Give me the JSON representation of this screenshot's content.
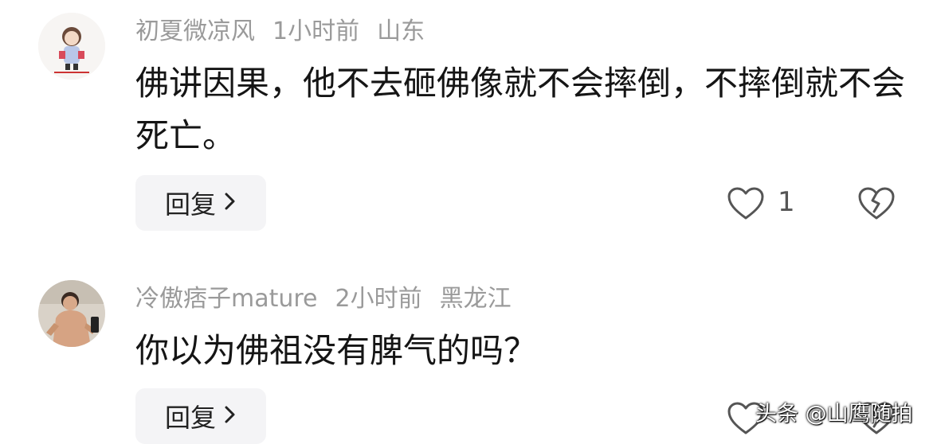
{
  "comments": [
    {
      "username": "初夏微凉风",
      "time": "1小时前",
      "location": "山东",
      "text": "佛讲因果，他不去砸佛像就不会摔倒，不摔倒就不会死亡。",
      "reply_label": "回复",
      "like_count": "1"
    },
    {
      "username": "冷傲痞子mature",
      "time": "2小时前",
      "location": "黑龙江",
      "text": "你以为佛祖没有脾气的吗？",
      "reply_label": "回复"
    }
  ],
  "watermark": "头条 @山鹰随拍",
  "icons": {
    "like": "heart-icon",
    "dislike": "broken-heart-icon",
    "reply_chevron": "chevron-right-icon"
  },
  "colors": {
    "meta_text": "#9a9a9a",
    "body_text": "#151515",
    "reply_bg": "#f4f4f6"
  }
}
